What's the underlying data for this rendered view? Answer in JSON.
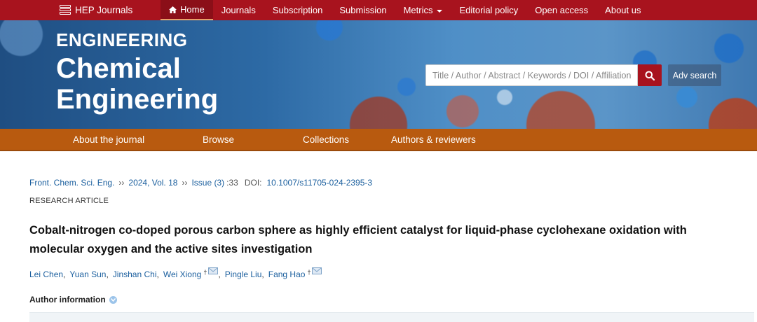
{
  "topnav": {
    "brand": "HEP Journals",
    "items": [
      {
        "label": "Home",
        "icon": "home-icon",
        "active": true
      },
      {
        "label": "Journals"
      },
      {
        "label": "Subscription"
      },
      {
        "label": "Submission"
      },
      {
        "label": "Metrics",
        "has_dropdown": true
      },
      {
        "label": "Editorial policy"
      },
      {
        "label": "Open access"
      },
      {
        "label": "About us"
      }
    ]
  },
  "banner": {
    "title_small": "ENGINEERING",
    "title_line1": "Chemical",
    "title_line2": "Engineering",
    "search_placeholder": "Title / Author / Abstract / Keywords / DOI / Affiliation",
    "search_icon": "search-icon",
    "adv_search_label": "Adv search"
  },
  "subnav": {
    "items": [
      "About the journal",
      "Browse",
      "Collections",
      "Authors & reviewers"
    ]
  },
  "article": {
    "breadcrumb": {
      "journal": "Front. Chem. Sci. Eng.",
      "sep": "››",
      "year_vol": "2024, Vol. 18",
      "issue": "Issue (3)",
      "article_no": ":33",
      "doi_label": "DOI:",
      "doi": "10.1007/s11705-024-2395-3"
    },
    "type": "RESEARCH ARTICLE",
    "title": "Cobalt-nitrogen co-doped porous carbon sphere as highly efficient catalyst for liquid-phase cyclohexane oxidation with molecular oxygen and the active sites investigation",
    "authors": [
      {
        "name": "Lei Chen"
      },
      {
        "name": "Yuan Sun"
      },
      {
        "name": "Jinshan Chi"
      },
      {
        "name": "Wei Xiong",
        "corresponding": true
      },
      {
        "name": "Pingle Liu"
      },
      {
        "name": "Fang Hao",
        "corresponding": true
      }
    ],
    "corresponding_mark": "†",
    "author_info_label": "Author information"
  },
  "colors": {
    "topnav_bg": "#a8131e",
    "subnav_bg": "#b85a0f",
    "link": "#1b5f9e"
  }
}
